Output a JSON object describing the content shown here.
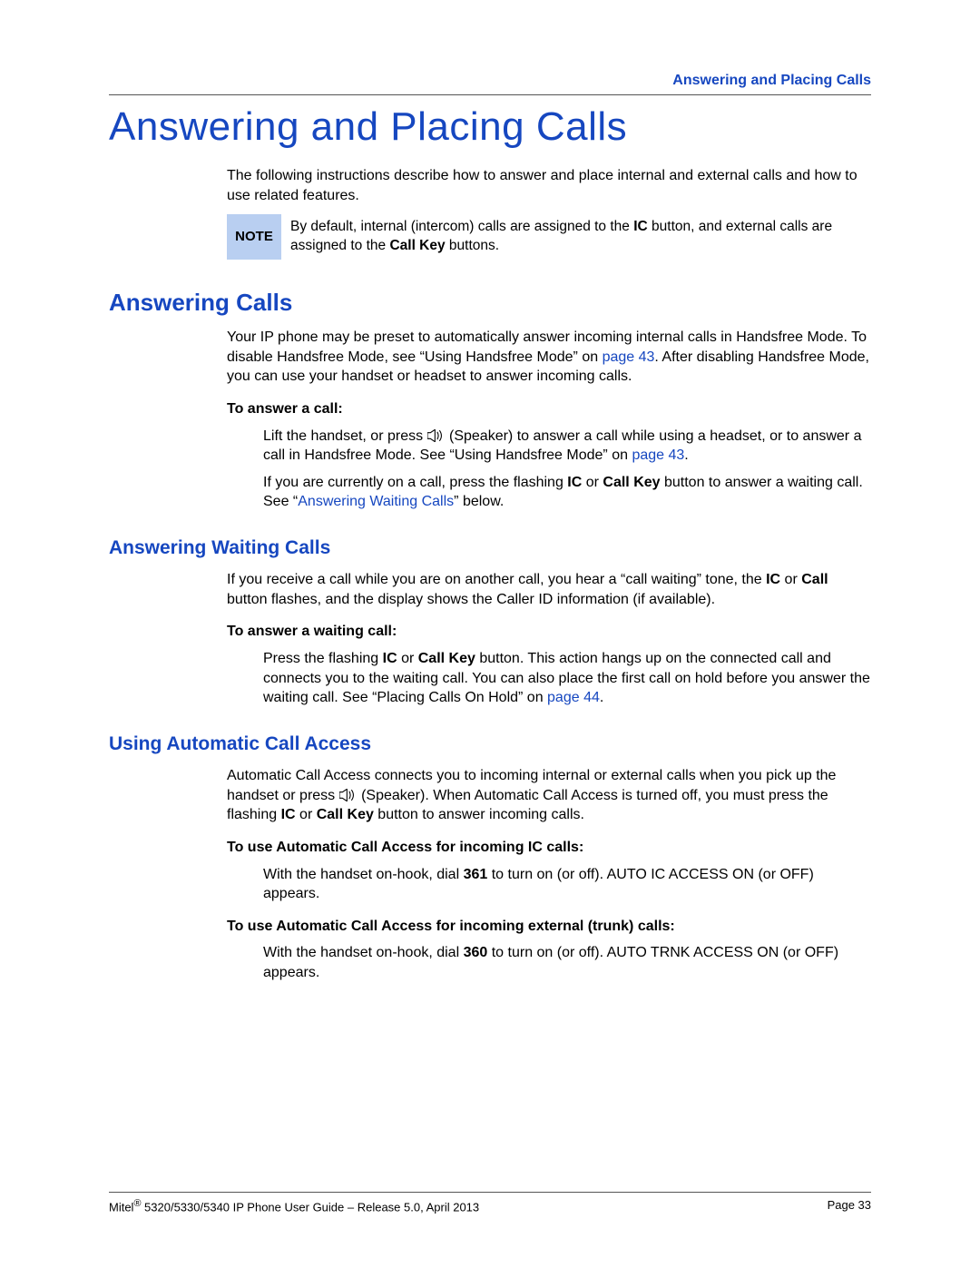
{
  "header": {
    "section": "Answering and Placing Calls"
  },
  "title": "Answering and Placing Calls",
  "intro": "The following instructions describe how to answer and place internal and external calls and how to use related features.",
  "note": {
    "label": "NOTE",
    "prefix": "By default, internal (intercom) calls are assigned to the ",
    "ic": "IC",
    "mid": " button, and external calls are assigned to the ",
    "ck": "Call Key",
    "suffix": " buttons."
  },
  "s1": {
    "heading": "Answering Calls",
    "p1a": "Your IP phone may be preset to automatically answer incoming internal calls in Handsfree Mode. To disable Handsfree Mode, see “Using Handsfree Mode” on ",
    "p1link": "page 43",
    "p1b": ". After disabling Handsfree Mode, you can use your handset or headset to answer incoming calls.",
    "sub1": "To answer a call:",
    "step1a": "Lift the handset, or press ",
    "step1b": " (Speaker) to answer a call while using a headset, or to answer a call in Handsfree Mode. See “Using Handsfree Mode” on ",
    "step1link": "page 43",
    "step1c": ".",
    "step2a": "If you are currently on a call, press the flashing ",
    "step2ic": "IC",
    "step2mid": " or ",
    "step2ck": "Call Key",
    "step2b": " button to answer a waiting call. See “",
    "step2link": "Answering Waiting Calls",
    "step2c": "” below."
  },
  "s2": {
    "heading": "Answering Waiting Calls",
    "p1a": "If you receive a call while you are on another call, you hear a “call waiting” tone, the ",
    "p1ic": "IC",
    "p1mid": " or ",
    "p1call": "Call",
    "p1b": " button flashes, and the display shows the Caller ID information (if available).",
    "sub1": "To answer a waiting call:",
    "step1a": "Press the flashing ",
    "step1ic": "IC",
    "step1mid": " or ",
    "step1ck": "Call Key",
    "step1b": " button. This action hangs up on the connected call and connects you to the waiting call. You can also place the first call on hold before you answer the waiting call. See “Placing Calls On Hold” on ",
    "step1link": "page 44",
    "step1c": "."
  },
  "s3": {
    "heading": "Using Automatic Call Access",
    "p1a": "Automatic Call Access connects you to incoming internal or external calls when you pick up the handset or press ",
    "p1b": " (Speaker). When Automatic Call Access is turned off, you must press the flashing ",
    "p1ic": "IC",
    "p1mid": " or ",
    "p1ck": "Call Key",
    "p1c": " button to answer incoming calls.",
    "sub1": "To use Automatic Call Access for incoming IC calls:",
    "step1a": "With the handset on-hook, dial ",
    "step1num": "361",
    "step1b": " to turn on (or off). AUTO IC ACCESS ON (or OFF) appears.",
    "sub2": "To use Automatic Call Access for incoming external (trunk) calls:",
    "step2a": "With the handset on-hook, dial ",
    "step2num": "360",
    "step2b": " to turn on (or off). AUTO TRNK ACCESS ON (or OFF) appears."
  },
  "footer": {
    "left_a": "Mitel",
    "left_sup": "®",
    "left_b": " 5320/5330/5340 IP Phone User Guide – Release 5.0, April 2013",
    "right": "Page 33"
  }
}
